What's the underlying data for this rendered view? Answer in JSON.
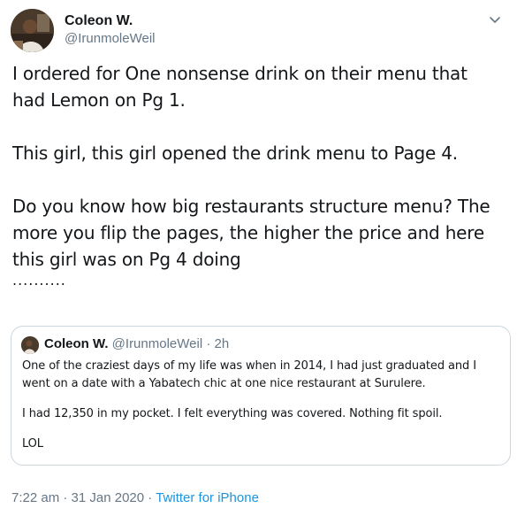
{
  "tweet": {
    "author": {
      "display_name": "Coleon W.",
      "handle": "@IrunmoleWeil",
      "avatar_icon": "user-avatar-photo"
    },
    "more_icon": "chevron-down-icon",
    "text": {
      "p1_line1": "I ordered for One nonsense drink on their menu that",
      "p1_line2": "had Lemon on Pg 1.",
      "p2": "This girl, this girl opened the drink menu to Page 4.",
      "p3_line1": "Do you know how big restaurants structure menu? The",
      "p3_line2": "more you flip the pages, the higher the price and here",
      "p3_line3": "this girl was on Pg 4 doing",
      "p3_dots": ".........."
    },
    "quoted": {
      "display_name": "Coleon W.",
      "handle": "@IrunmoleWeil",
      "separator": " · ",
      "time": "2h",
      "p1_line1": "One of the craziest days of my life was when in 2014, I had just graduated and I",
      "p1_line2": "went on a date with a Yabatech chic at one nice restaurant at Surulere.",
      "p2": "I had 12,350 in my pocket. I felt everything was covered. Nothing fit spoil.",
      "p3": "LOL"
    },
    "footer": {
      "time": "7:22 am",
      "separator1": " · ",
      "date": "31 Jan 2020",
      "separator2": " · ",
      "source": "Twitter for iPhone"
    }
  },
  "colors": {
    "text": "#14171a",
    "secondary": "#657786",
    "link": "#1b95e0",
    "border": "#ccd6dd"
  }
}
